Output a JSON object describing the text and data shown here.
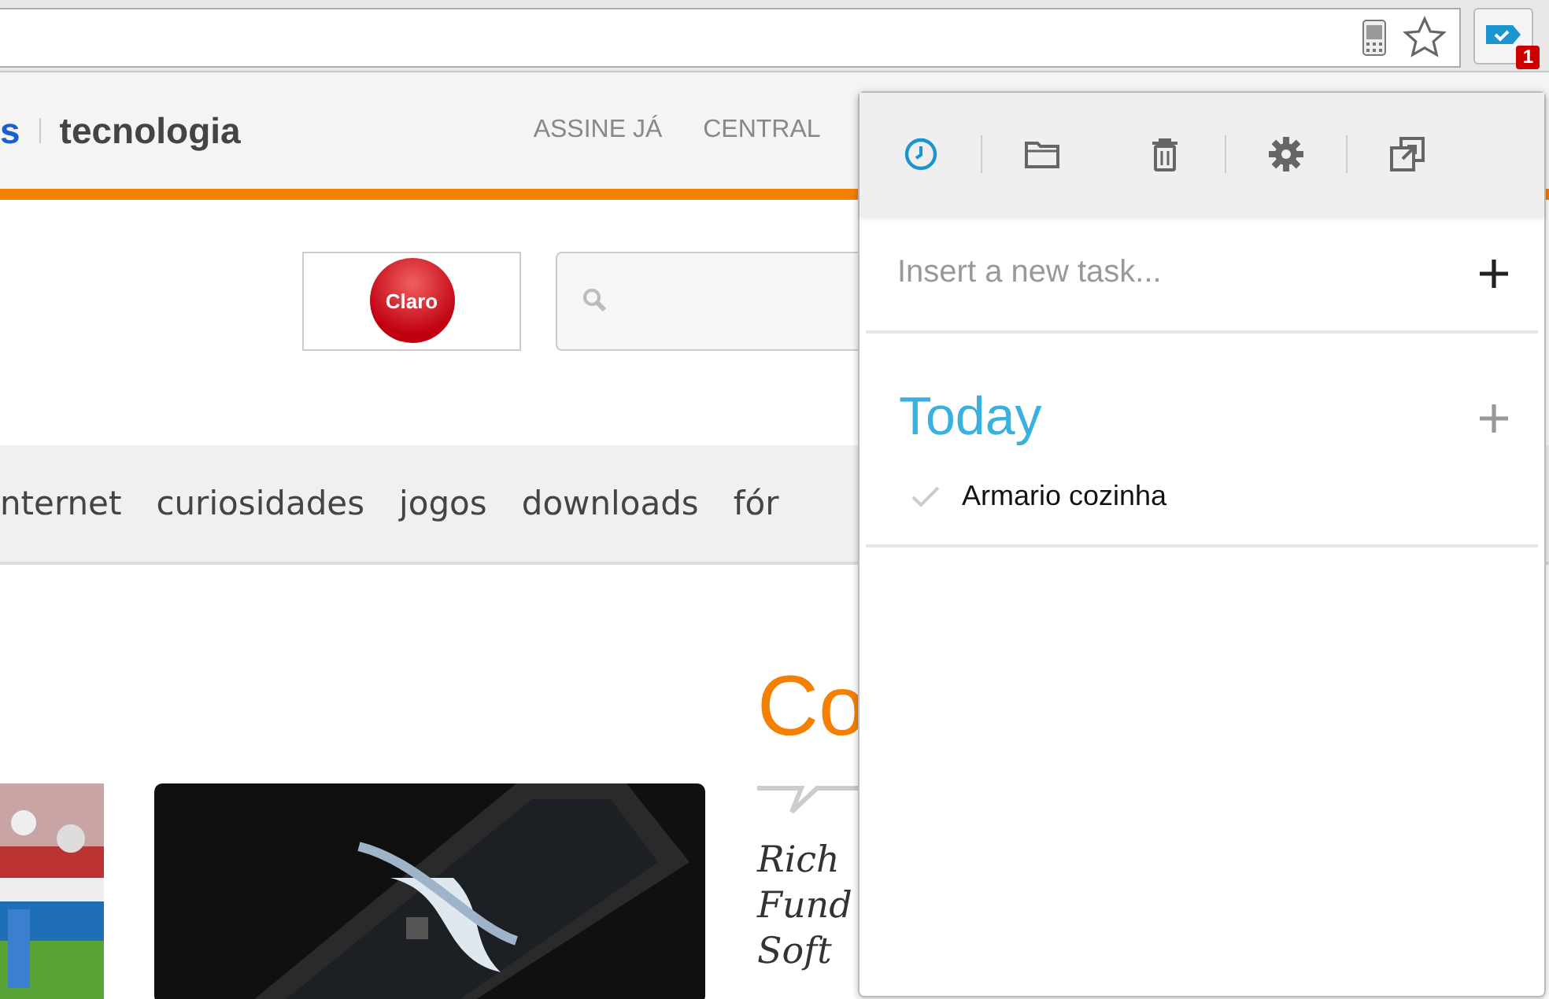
{
  "browser": {
    "extension_badge": "1"
  },
  "site": {
    "brand_prefix": "s",
    "brand": "tecnologia",
    "top_links": [
      "ASSINE JÁ",
      "CENTRAL"
    ],
    "sponsor": "Claro",
    "nav": [
      "nternet",
      "curiosidades",
      "jogos",
      "downloads",
      "fór"
    ],
    "headline": "Co",
    "teaser_lines": [
      "Rich",
      "Fund",
      "Soft"
    ],
    "images": [
      {
        "kind": "picture"
      },
      {
        "kind": "picture"
      }
    ]
  },
  "popup": {
    "toolbar": [
      {
        "kind": "clock",
        "selected": true,
        "divider": true
      },
      {
        "kind": "folder",
        "selected": false,
        "divider": false
      },
      {
        "kind": "trash",
        "selected": false,
        "divider": true
      },
      {
        "kind": "gear",
        "selected": false,
        "divider": true
      },
      {
        "kind": "windows",
        "selected": false,
        "divider": false
      }
    ],
    "new_task": {
      "placeholder": "Insert a new task..."
    },
    "sections": [
      {
        "title": "Today",
        "tasks": [
          {
            "title": "Armario cozinha",
            "done": false
          }
        ]
      }
    ]
  }
}
